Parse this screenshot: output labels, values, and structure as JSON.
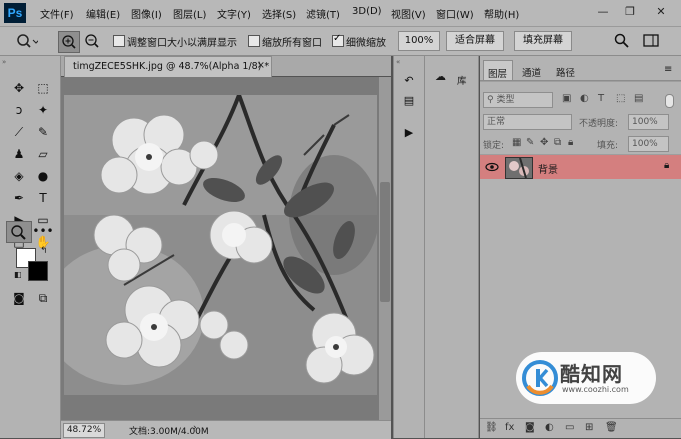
{
  "app": {
    "logo": "Ps"
  },
  "menu": [
    "文件(F)",
    "编辑(E)",
    "图像(I)",
    "图层(L)",
    "文字(Y)",
    "选择(S)",
    "滤镜(T)",
    "3D(D)",
    "视图(V)",
    "窗口(W)",
    "帮助(H)"
  ],
  "window_controls": {
    "minimize": "—",
    "restore": "❐",
    "close": "✕"
  },
  "options_bar": {
    "resize_windows_label": "调整窗口大小以满屏显示",
    "resize_windows_checked": false,
    "zoom_all_label": "缩放所有窗口",
    "zoom_all_checked": false,
    "scrubby_zoom_label": "细微缩放",
    "scrubby_zoom_checked": true,
    "percent_button": "100%",
    "fit_screen_button": "适合屏幕",
    "fill_screen_button": "填充屏幕"
  },
  "document": {
    "tab_title": "timgZECE5SHK.jpg @ 48.7%(Alpha 1/8) *",
    "tab_close": "×",
    "zoom": "48.72%",
    "doc_size": "文档:3.00M/4.00M"
  },
  "library": {
    "label": "库"
  },
  "layers_panel": {
    "tabs": [
      "图层",
      "通道",
      "路径"
    ],
    "filter_placeholder": "类型",
    "blend_mode": "正常",
    "opacity_label": "不透明度:",
    "opacity_value": "100%",
    "lock_label": "锁定:",
    "fill_label": "填充:",
    "fill_value": "100%",
    "layers": [
      {
        "name": "背景",
        "visible": true,
        "locked": true
      }
    ]
  },
  "watermark": {
    "title": "酷知网",
    "url": "www.coozhi.com"
  },
  "colors": {
    "layer_highlight": "#d47f7f",
    "ps_blue": "#31a8ff",
    "ps_dark": "#001e36"
  }
}
